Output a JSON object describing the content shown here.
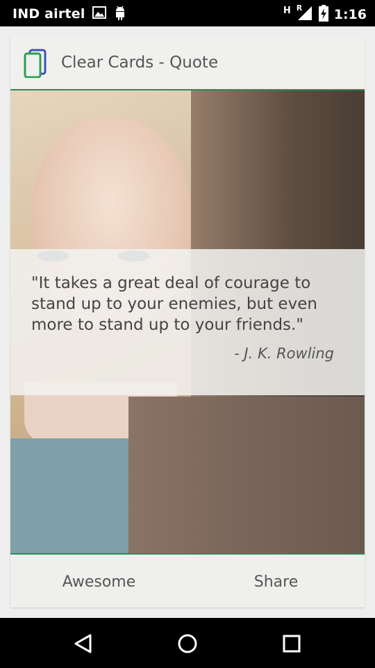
{
  "status_bar": {
    "carrier": "IND airtel",
    "network_h": "H",
    "network_r": "R",
    "time": "1:16",
    "icons": [
      "image-icon",
      "android-icon",
      "signal-icon",
      "battery-charging-icon"
    ]
  },
  "card": {
    "title": "Clear Cards - Quote",
    "icon": "cards-app-icon",
    "quote": {
      "text": "\"It takes a great deal of courage to stand up to your enemies, but even more to stand up to your friends.\"",
      "author": "- J. K. Rowling"
    },
    "actions": {
      "awesome_label": "Awesome",
      "share_label": "Share"
    },
    "accent_color": "#2e8b57"
  },
  "nav_bar": {
    "buttons": [
      "back-icon",
      "home-icon",
      "recent-apps-icon"
    ]
  }
}
